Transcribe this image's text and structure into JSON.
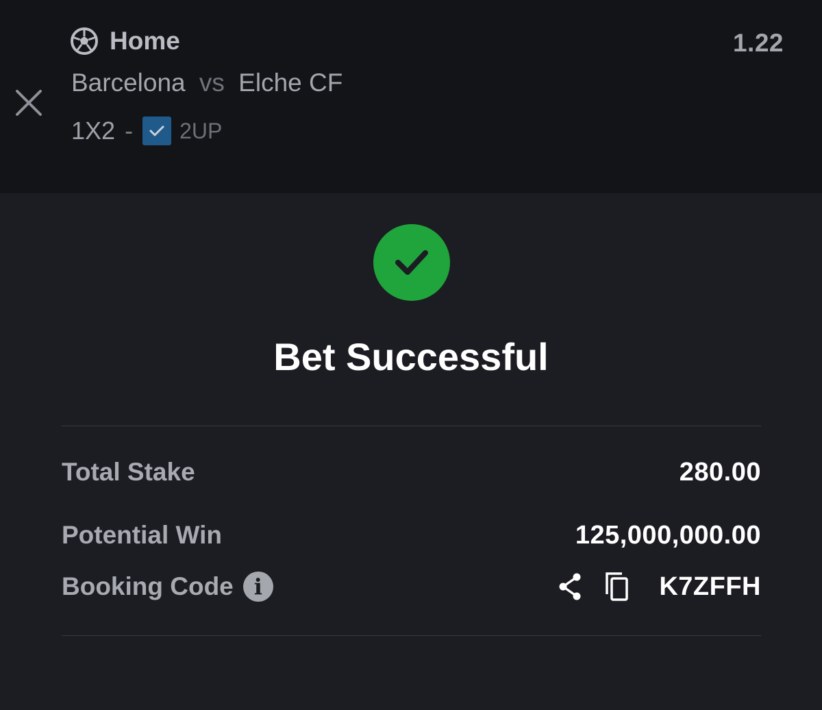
{
  "bet_selection": {
    "market_icon": "soccer-ball-icon",
    "market": "Home",
    "odds": "1.22",
    "home_team": "Barcelona",
    "vs": "vs",
    "away_team": "Elche CF",
    "bet_type": "1X2",
    "separator": "-",
    "option_label": "2UP",
    "option_checked": true,
    "close_icon": "close-icon"
  },
  "confirmation": {
    "status_icon": "checkmark-circle-icon",
    "title": "Bet Successful"
  },
  "summary": {
    "total_stake_label": "Total Stake",
    "total_stake_value": "280.00",
    "potential_win_label": "Potential Win",
    "potential_win_value": "125,000,000.00",
    "booking_code_label": "Booking Code",
    "booking_code_value": "K7ZFFH",
    "info_icon": "info-icon",
    "share_icon": "share-icon",
    "copy_icon": "copy-icon",
    "info_glyph": "i"
  },
  "colors": {
    "top_background": "#131418",
    "background": "#1c1d22",
    "success_green": "#1fa53c",
    "checkbox_blue": "#1f5a8a"
  }
}
